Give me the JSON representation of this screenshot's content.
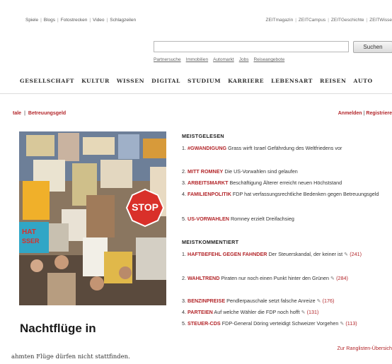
{
  "toplinks": [
    "Spiele",
    "Blogs",
    "Fotostrecken",
    "Video",
    "Schlagzeilen"
  ],
  "rightlinks": [
    "ZEITmagazin",
    "ZEITCampus",
    "ZEITGeschichte",
    "ZEITWisse"
  ],
  "search": {
    "placeholder": "",
    "button_label": "Suchen"
  },
  "sublinks": [
    "Partnersuche",
    "Immobilien",
    "Automarkt",
    "Jobs",
    "Reiseangebote"
  ],
  "nav": [
    "GESELLSCHAFT",
    "KULTUR",
    "WISSEN",
    "DIGITAL",
    "STUDIUM",
    "KARRIERE",
    "LEBENSART",
    "REISEN",
    "AUTO"
  ],
  "breadcrumb": [
    "tale",
    "Betreuungsgeld"
  ],
  "login": {
    "login_label": "Anmelden",
    "register_label": "Registriere"
  },
  "headline": "Nachtflüge in",
  "subtext": "ahmten Flüge dürfen nicht stattfinden.",
  "meistgelesen": {
    "title": "MEISTGELESEN",
    "items": [
      {
        "num": "1.",
        "kw": "#Gwandigung",
        "text": "Grass wirft Israel Gefährdung des Weltfriedens vor"
      },
      {
        "num": "2.",
        "kw": "Mitt Romney",
        "text": "Die US-Vorwahlen sind gelaufen"
      },
      {
        "num": "3.",
        "kw": "Arbeitsmarkt",
        "text": "Beschäftigung Älterer erreicht neuen Höchststand"
      },
      {
        "num": "4.",
        "kw": "Familienpolitik",
        "text": "FDP hat verfassungsrechtliche Bedenken gegen Betreuungsgeld"
      },
      {
        "num": "5.",
        "kw": "US-Vorwahlen",
        "text": "Romney erzielt Dreifachsieg"
      }
    ]
  },
  "meistkommentiert": {
    "title": "MEISTKOMMENTIERT",
    "items": [
      {
        "num": "1.",
        "kw": "Haftbefehl gegen Fahnder",
        "text": "Der Steuerskandal, der keiner ist",
        "count": "(241)"
      },
      {
        "num": "2.",
        "kw": "Wahltrend",
        "text": "Piraten nur noch einen Punkt hinter den Grünen",
        "count": "(284)"
      },
      {
        "num": "3.",
        "kw": "Benzinpreise",
        "text": "Pendlerpauschale setzt falsche Anreize",
        "count": "(176)"
      },
      {
        "num": "4.",
        "kw": "Parteien",
        "text": "Auf welche Wähler die FDP noch hofft",
        "count": "(131)"
      },
      {
        "num": "5.",
        "kw": "Steuer-CDs",
        "text": "FDP-General Döring verteidigt Schweizer Vorgehen",
        "count": "(113)"
      }
    ]
  },
  "ranglisten_link": "Zur Ranglisten-Übersich",
  "photo_sign_texts": [
    "STOP",
    "HAT",
    "SSER"
  ],
  "colors": {
    "accent": "#b3262a"
  }
}
